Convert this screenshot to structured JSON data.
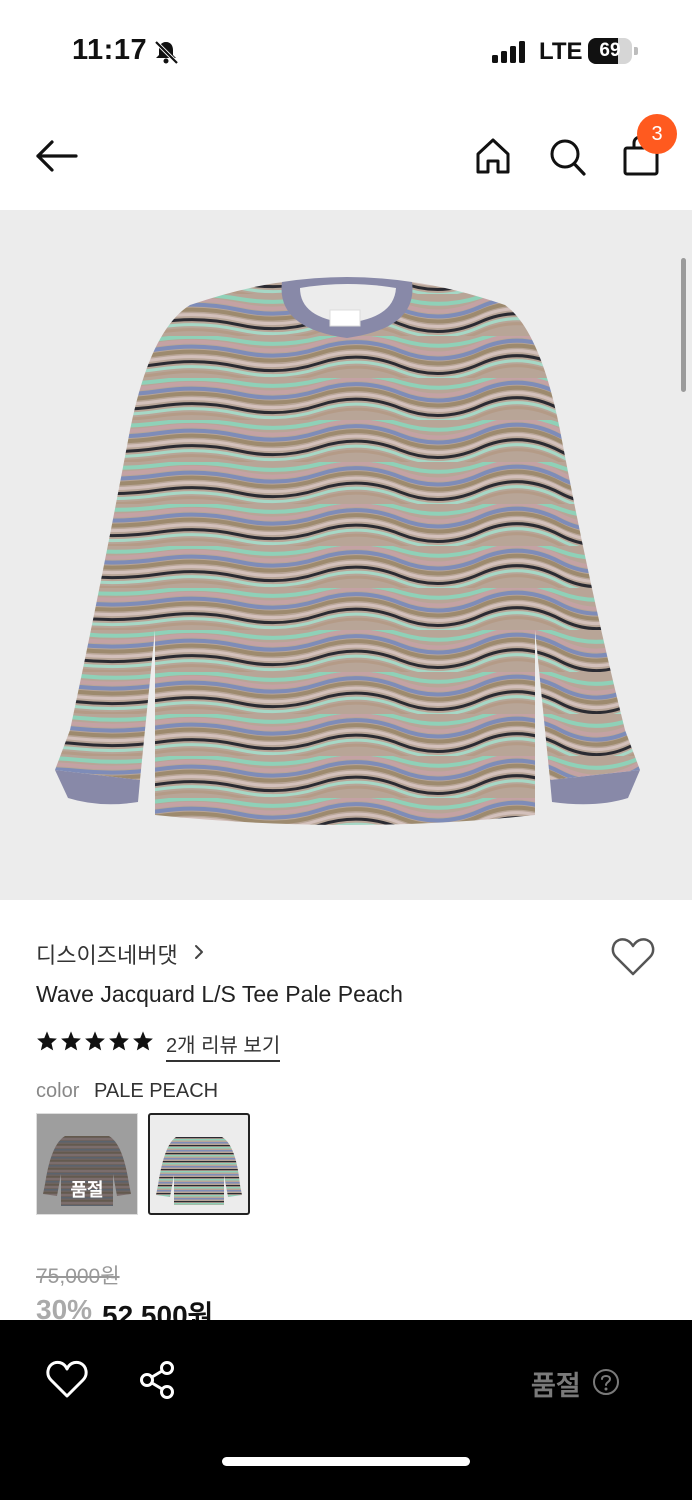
{
  "status_bar": {
    "time": "11:17",
    "network": "LTE",
    "battery": "69",
    "battery_level": 0.69,
    "icons": [
      "bell-slash-icon",
      "signal-icon",
      "battery-icon"
    ]
  },
  "nav": {
    "cart_count": "3",
    "icons": [
      "back-arrow-icon",
      "home-icon",
      "search-icon",
      "shopping-bag-icon"
    ]
  },
  "product": {
    "brand": "디스이즈네버댓",
    "title": "Wave Jacquard L/S Tee Pale Peach",
    "rating": 5,
    "rating_max": 5,
    "reviews_link": "2개 리뷰 보기",
    "color_label": "color",
    "color_value": "PALE PEACH",
    "swatches": [
      {
        "sold_out_label": "품절",
        "selected": false
      },
      {
        "selected": true
      }
    ],
    "original_price": "75,000원",
    "discount": "30%",
    "sale_price": "52,500원"
  },
  "bottom_bar": {
    "soldout_label": "품절",
    "icons": [
      "heart-icon",
      "share-icon",
      "help-circle-icon"
    ]
  },
  "colors": {
    "badge": "#ff5a1f",
    "bottom_bar": "#000000",
    "hero_bg": "#ececec"
  }
}
